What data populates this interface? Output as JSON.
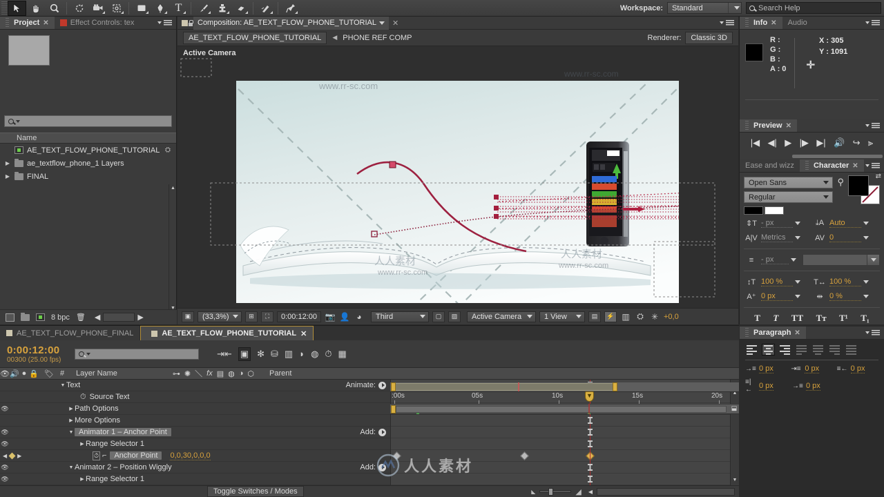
{
  "toolbar": {
    "tools": [
      {
        "name": "selection-tool",
        "glyph": "➤",
        "selected": true
      },
      {
        "name": "hand-tool",
        "glyph": "✋",
        "selected": false
      },
      {
        "name": "zoom-tool",
        "glyph": "🔍",
        "selected": false
      },
      {
        "name": "rotation-tool",
        "glyph": "↻",
        "selected": false
      },
      {
        "name": "camera-tool",
        "glyph": "🎥",
        "selected": false
      },
      {
        "name": "pan-behind-tool",
        "glyph": "✥",
        "selected": false
      },
      {
        "name": "shape-tool",
        "glyph": "▮",
        "selected": false
      },
      {
        "name": "pen-tool",
        "glyph": "✒",
        "selected": false
      },
      {
        "name": "type-tool",
        "glyph": "T",
        "selected": false
      },
      {
        "name": "brush-tool",
        "glyph": "🖌",
        "selected": false
      },
      {
        "name": "clone-stamp-tool",
        "glyph": "⚲",
        "selected": false
      },
      {
        "name": "eraser-tool",
        "glyph": "▬",
        "selected": false
      },
      {
        "name": "roto-brush-tool",
        "glyph": "✎",
        "selected": false
      },
      {
        "name": "puppet-pin-tool",
        "glyph": "📌",
        "selected": false
      }
    ],
    "workspace_label": "Workspace:",
    "workspace_value": "Standard",
    "search_placeholder": "Search Help"
  },
  "project": {
    "tabs": [
      {
        "label": "Project",
        "active": true,
        "closable": true
      },
      {
        "label": "Effect Controls: tex",
        "active": false,
        "closable": false
      }
    ],
    "search_value": "",
    "column_header": "Name",
    "items": [
      {
        "label": "AE_TEXT_FLOW_PHONE_TUTORIAL",
        "type": "comp",
        "indent": 0,
        "twirl": false
      },
      {
        "label": "ae_textflow_phone_1 Layers",
        "type": "folder",
        "indent": 0,
        "twirl": true
      },
      {
        "label": "FINAL",
        "type": "folder",
        "indent": 0,
        "twirl": true
      }
    ],
    "footer": {
      "bpc": "8 bpc"
    }
  },
  "composition": {
    "tab_title": "Composition: AE_TEXT_FLOW_PHONE_TUTORIAL",
    "breadcrumb_comp": "AE_TEXT_FLOW_PHONE_TUTORIAL",
    "breadcrumb_child": "PHONE REF COMP",
    "renderer_label": "Renderer:",
    "renderer_value": "Classic 3D",
    "view_label": "Active Camera",
    "footer": {
      "magnification": "(33,3%)",
      "time": "0:00:12:00",
      "resolution": "Third",
      "camera_view": "Active Camera",
      "view_count": "1 View",
      "exposure": "+0,0"
    },
    "watermarks": [
      "www.rr-sc.com",
      "www.rr-sc.com",
      "www.rr-sc.com",
      "人人素材",
      "人人素材",
      "www.rr-sc.com"
    ]
  },
  "info": {
    "tabs": [
      {
        "label": "Info",
        "active": true
      },
      {
        "label": "Audio",
        "active": false
      }
    ],
    "r_label": "R :",
    "g_label": "G :",
    "b_label": "B :",
    "a_label": "A : 0",
    "x_label": "X : 305",
    "y_label": "Y : 1091"
  },
  "preview": {
    "tabs": [
      {
        "label": "Preview",
        "active": true
      }
    ],
    "buttons": [
      {
        "name": "first-frame-button",
        "glyph": "|◀"
      },
      {
        "name": "previous-frame-button",
        "glyph": "◀|"
      },
      {
        "name": "play-button",
        "glyph": "▶"
      },
      {
        "name": "next-frame-button",
        "glyph": "|▶"
      },
      {
        "name": "last-frame-button",
        "glyph": "▶|"
      },
      {
        "name": "audio-button",
        "glyph": "🔊"
      },
      {
        "name": "loop-button",
        "glyph": "↪"
      },
      {
        "name": "ram-preview-button",
        "glyph": "⫸"
      }
    ]
  },
  "character": {
    "tabs": [
      {
        "label": "Ease and wizz",
        "active": false
      },
      {
        "label": "Character",
        "active": true
      }
    ],
    "font_family": "Open Sans",
    "font_style": "Regular",
    "font_size": "- px",
    "leading": "Auto",
    "kerning": "Metrics",
    "tracking": "0",
    "stroke_width": "- px",
    "vertical_scale": "100 %",
    "horizontal_scale": "100 %",
    "baseline_shift": "0 px",
    "tsume": "0 %",
    "style_buttons": [
      "T",
      "T",
      "TT",
      "Tт",
      "T¹",
      "T₁"
    ]
  },
  "paragraph": {
    "tabs": [
      {
        "label": "Paragraph",
        "active": true
      }
    ],
    "indent_left": "0 px",
    "indent_first": "0 px",
    "indent_right": "0 px",
    "space_before": "0 px",
    "space_after": "0 px"
  },
  "timeline": {
    "tabs": [
      {
        "label": "AE_TEXT_FLOW_PHONE_FINAL",
        "active": false
      },
      {
        "label": "AE_TEXT_FLOW_PHONE_TUTORIAL",
        "active": true
      }
    ],
    "current_time": "0:00:12:00",
    "frames_fps": "00300 (25.00 fps)",
    "search_value": "",
    "columns": {
      "index": "#",
      "layer_name": "Layer Name",
      "parent": "Parent"
    },
    "rows": [
      {
        "name": "Text",
        "indent": 2,
        "twirl": "down",
        "eye": false,
        "right_label": "Animate:",
        "right_button": true,
        "highlight": false
      },
      {
        "name": "Source Text",
        "indent": 4,
        "twirl": "none",
        "stopwatch": true,
        "eye": false,
        "highlight": false
      },
      {
        "name": "Path Options",
        "indent": 3,
        "twirl": "right",
        "eye": true,
        "highlight": false
      },
      {
        "name": "More Options",
        "indent": 3,
        "twirl": "right",
        "eye": false,
        "highlight": false
      },
      {
        "name": "Animator 1 – Anchor Point",
        "indent": 3,
        "twirl": "down",
        "eye": true,
        "right_label": "Add:",
        "right_button": true,
        "highlight": true
      },
      {
        "name": "Range Selector 1",
        "indent": 4,
        "twirl": "right",
        "eye": true,
        "highlight": false
      },
      {
        "name": "Anchor Point",
        "indent": 5,
        "twirl": "none",
        "eye": false,
        "value": "0,0,30,0,0,0",
        "keyframe_nav": true,
        "highlight": true
      },
      {
        "name": "Animator 2 – Position Wiggly",
        "indent": 3,
        "twirl": "down",
        "eye": true,
        "right_label": "Add:",
        "right_button": true,
        "highlight": false
      },
      {
        "name": "Range Selector 1",
        "indent": 4,
        "twirl": "right",
        "eye": true,
        "highlight": false
      }
    ],
    "ruler_labels": [
      ":00s",
      "05s",
      "10s",
      "15s",
      "20s"
    ],
    "ruler_values": [
      0,
      5,
      10,
      15,
      20
    ],
    "playhead_time": 12,
    "keyframes": [
      {
        "time": 0.2
      },
      {
        "time": 7.6
      },
      {
        "time": 12,
        "selected": true
      }
    ],
    "work_area": {
      "start": 0,
      "end": 15.9
    },
    "footer": {
      "toggle_label": "Toggle Switches / Modes"
    }
  }
}
